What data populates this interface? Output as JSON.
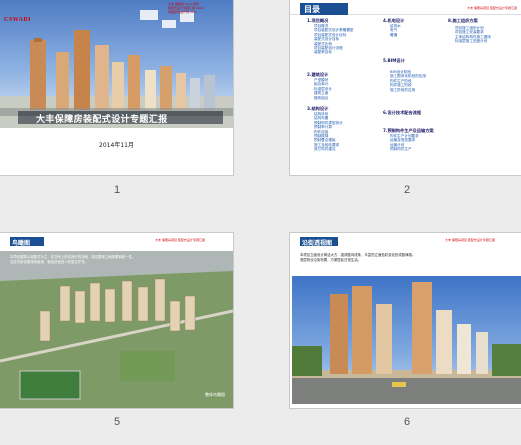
{
  "slides": [
    {
      "number": "1",
      "logo": "CSWADI",
      "meta": [
        "大丰 保障房 xxxx 项目",
        "装配式设计专题汇报 2014",
        "中国建筑设计院 xxxx"
      ],
      "title": "大丰保障房装配式设计专题汇报",
      "date": "2014年11月"
    },
    {
      "number": "2",
      "header": "目录",
      "header_right": "大丰 保障房项目 装配式设计专题汇报",
      "sections": [
        {
          "title": "1.项目概况",
          "items": [
            "项目概况",
            "项目装配式设计策略模型",
            "项目装配式设计目标",
            "装配式设计目标",
            "装配式比例",
            "项目装配设计流程",
            "装配率目标"
          ]
        },
        {
          "title": "2.建筑设计",
          "items": [
            "户型模块",
            "组合单元",
            "标准层设计",
            "建筑立面",
            "楼栋组合"
          ]
        },
        {
          "title": "3.结构设计",
          "items": [
            "结构体系",
            "结构布置",
            "预制构件类型拆分",
            "预制率计算",
            "构件连接",
            "预制楼梯",
            "预制叠合楼板",
            "施工及验收要求",
            "其它构件建议"
          ]
        },
        {
          "title": "4.机电设计",
          "items": [
            "给排水",
            "电气",
            "暖通"
          ]
        },
        {
          "title": "5.BIM设计",
          "items": [
            "BIM设计阶段",
            "施工图深化阶段的应用",
            "构件生产阶段",
            "构件施工阶段",
            "施工阶段的应用"
          ]
        },
        {
          "title": "6.设计技术配合流程",
          "items": []
        },
        {
          "title": "7.预制构件生产及运输方案",
          "items": [
            "构件生产计划要求",
            "运输及堆放要求",
            "运输计划",
            "预制构件生产"
          ]
        },
        {
          "title": "8.施工组织方案",
          "items": [
            "项目施工组织计划",
            "项目施工安装要求",
            "主体结构构件施工顺序",
            "标准层施工进度计划"
          ]
        }
      ]
    },
    {
      "number": "5",
      "header": "鸟瞰图",
      "header_right": "大丰 保障房项目 装配式设计专题汇报",
      "note": [
        "本项目建筑以装配式为主，在空间上形成良好的场地，保证整体立面效果和统一性。",
        "住区内部设置绿地景观，营造舒适宜人的居住环境。"
      ],
      "caption": "整体鸟瞰图"
    },
    {
      "number": "6",
      "header": "沿街透视图",
      "header_right": "大丰 保障房项目 装配式设计专题汇报",
      "note": [
        "本项目立面设计简洁大方，强调竖向线条，丰富的立面色彩变化形成韵律感。",
        "底层商业沿街布置，方便居民日常生活。"
      ]
    }
  ]
}
